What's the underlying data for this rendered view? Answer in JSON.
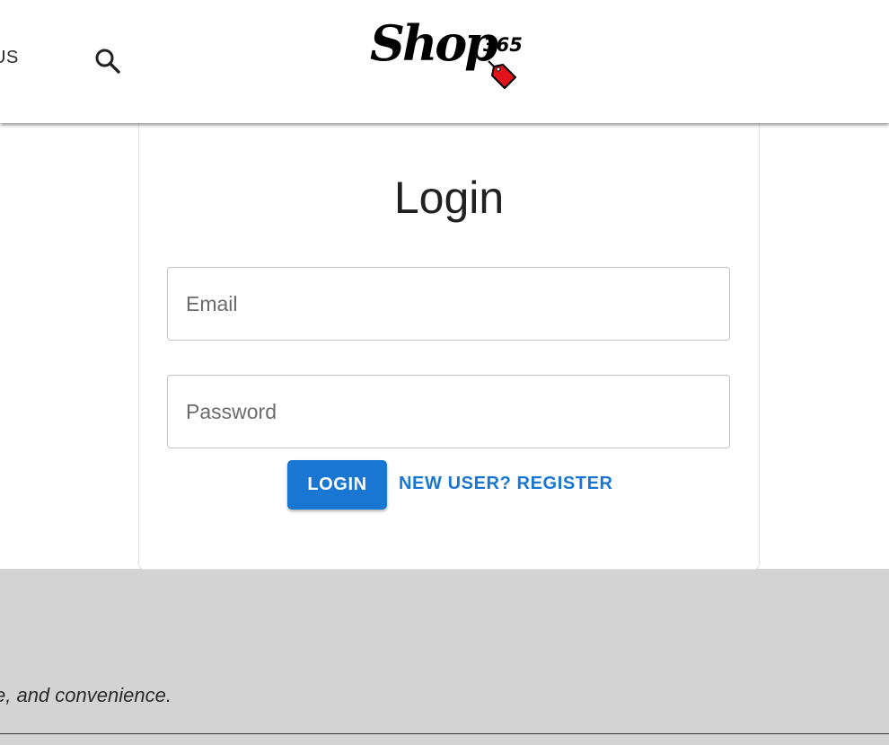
{
  "header": {
    "nav_partial_label": "US",
    "search_icon": "search-icon",
    "logo": {
      "word": "Shop",
      "number": "365",
      "tag_color": "#e2121a"
    }
  },
  "login_form": {
    "title": "Login",
    "email": {
      "placeholder": "Email",
      "value": ""
    },
    "password": {
      "placeholder": "Password",
      "value": ""
    },
    "login_button": "LOGIN",
    "register_link": "NEW USER? REGISTER",
    "accent_color": "#1976d2"
  },
  "footer": {
    "tagline_partial": "e, and convenience."
  }
}
